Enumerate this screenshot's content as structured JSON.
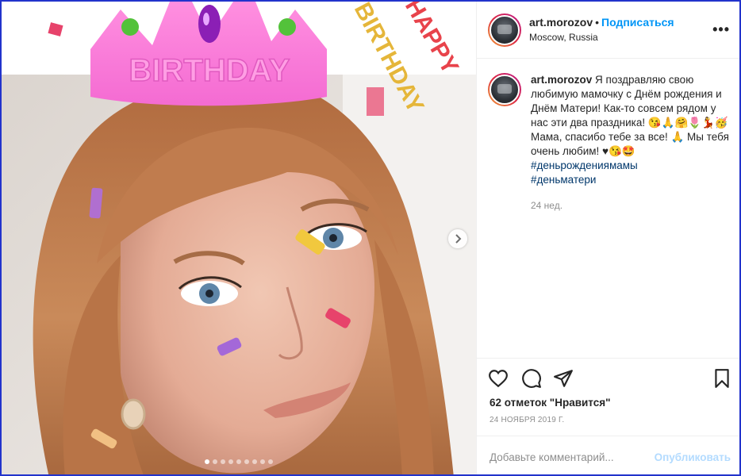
{
  "post": {
    "username": "art.morozov",
    "bullet": "•",
    "follow_label": "Подписаться",
    "location": "Moscow, Russia",
    "more_label": "•••"
  },
  "media": {
    "crown_text": "BIRTHDAY",
    "happy_text": "HAPPY",
    "birthday_text": "BIRTHDAY",
    "carousel_count": 9,
    "carousel_active": 1
  },
  "caption": {
    "username": "art.morozov",
    "text": "Я поздравляю свою любимую мамочку с Днём рождения и Днём Матери! Как-то совсем рядом у нас эти два праздника! 😘🙏🤗🌷💃🥳 Мама, спасибо тебе за все! 🙏 Мы тебя очень любим! ♥😘🤩",
    "hashtags": [
      "#деньрождениямамы",
      "#деньматери"
    ],
    "age": "24 нед."
  },
  "engagement": {
    "likes": "62 отметок \"Нравится\"",
    "date": "24 НОЯБРЯ 2019 Г."
  },
  "comment": {
    "placeholder": "Добавьте комментарий...",
    "publish_label": "Опубликовать"
  },
  "icons": {
    "like": "heart-icon",
    "comment": "speech-bubble-icon",
    "share": "paper-plane-icon",
    "save": "bookmark-icon",
    "next": "chevron-right-icon",
    "more": "ellipsis-icon"
  }
}
